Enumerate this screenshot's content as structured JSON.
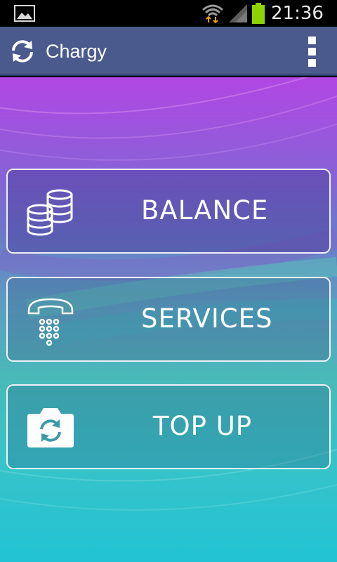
{
  "status_bar": {
    "time": "21:36",
    "icons": [
      "gallery-icon",
      "wifi-icon",
      "signal-icon",
      "battery-icon"
    ]
  },
  "action_bar": {
    "title": "Chargy",
    "app_icon": "refresh-icon",
    "overflow_icon": "overflow-menu-icon"
  },
  "menu": {
    "balance": {
      "label": "BALANCE",
      "icon": "coins-icon"
    },
    "services": {
      "label": "SERVICES",
      "icon": "telephone-icon"
    },
    "topup": {
      "label": "TOP UP",
      "icon": "camera-refresh-icon"
    }
  },
  "colors": {
    "action_bar": "#4a5a8c",
    "status_bar": "#000000",
    "battery": "#8fd400",
    "wifi_arrows": "#e9a300"
  }
}
